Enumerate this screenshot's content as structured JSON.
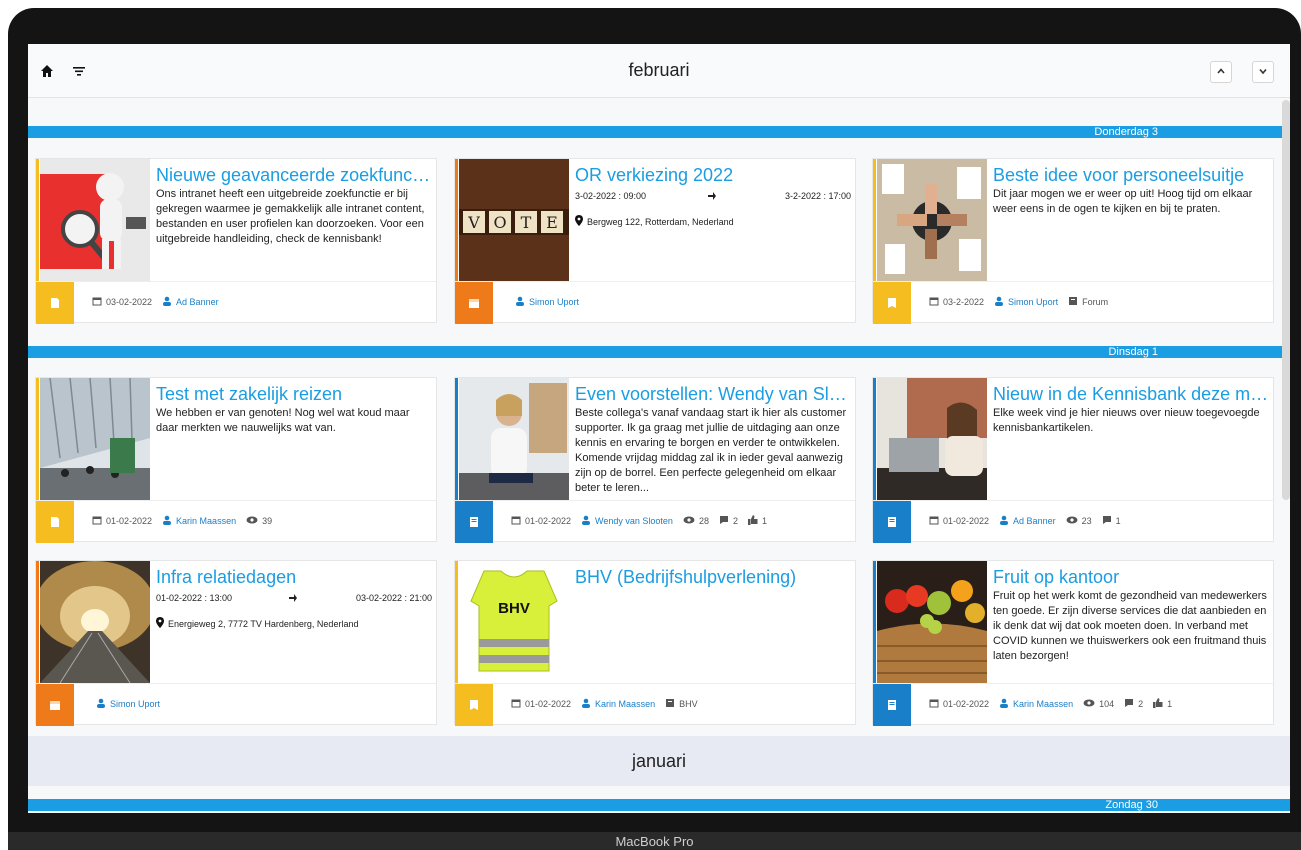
{
  "device": {
    "label": "MacBook Pro"
  },
  "header": {
    "month": "februari",
    "home_icon": "home-icon",
    "filter_icon": "filter-icon"
  },
  "colors": {
    "accent": "#1a9de2",
    "yellow": "#f5bd1f",
    "orange": "#ef7a1a",
    "blue": "#1a7fc9"
  },
  "days": [
    {
      "label": "Donderdag 3"
    },
    {
      "label": "Dinsdag 1"
    },
    {
      "label": "Zondag 30"
    }
  ],
  "cards": [
    {
      "title": "Nieuwe geavanceerde zoekfunc…",
      "body": "Ons intranet heeft een uitgebreide zoekfunctie er bij gekregen waarmee je gemakkelijk alle intranet content, bestanden en user profielen kan doorzoeken. Voor een uitgebreide handleiding, check de kennisbank!",
      "date": "03-02-2022",
      "author": "Ad Banner"
    },
    {
      "title": "OR verkiezing 2022",
      "start": "3-02-2022 : 09:00",
      "end": "3-2-2022 : 17:00",
      "location": "Bergweg 122, Rotterdam, Nederland",
      "author": "Simon Uport",
      "thumb_text": "VOTE"
    },
    {
      "title": "Beste idee voor personeelsuitje",
      "body": "Dit jaar mogen we er weer op uit! Hoog tijd om elkaar weer eens in de ogen te kijken en bij te praten.",
      "date": "03-2-2022",
      "author": "Simon Uport",
      "forum": "Forum"
    },
    {
      "title": "Test met zakelijk reizen",
      "body": "We hebben er van genoten! Nog wel wat koud maar daar merkten we nauwelijks wat van.",
      "date": "01-02-2022",
      "author": "Karin Maassen",
      "views": "39"
    },
    {
      "title": "Even voorstellen: Wendy van Sl…",
      "body": "Beste collega's vanaf vandaag start ik hier als customer supporter. Ik ga graag met jullie de uitdaging aan onze kennis en ervaring te borgen en verder te ontwikkelen. Komende vrijdag middag zal ik in ieder geval aanwezig zijn op de borrel. Een perfecte gelegenheid om elkaar beter te leren...",
      "date": "01-02-2022",
      "author": "Wendy van Slooten",
      "views": "28",
      "comments": "2",
      "likes": "1"
    },
    {
      "title": "Nieuw in de Kennisbank deze m…",
      "body": "Elke week vind je hier nieuws over nieuw toegevoegde kennisbankartikelen.",
      "date": "01-02-2022",
      "author": "Ad Banner",
      "views": "23",
      "comments": "1"
    },
    {
      "title": "Infra relatiedagen",
      "start": "01-02-2022 : 13:00",
      "end": "03-02-2022 : 21:00",
      "location": "Energieweg 2, 7772 TV Hardenberg, Nederland",
      "author": "Simon Uport"
    },
    {
      "title": "BHV (Bedrijfshulpverlening)",
      "date": "01-02-2022",
      "author": "Karin Maassen",
      "forum": "BHV",
      "thumb_text": "BHV"
    },
    {
      "title": "Fruit op kantoor",
      "body": "Fruit op het werk komt de gezondheid van medewerkers ten goede. Er zijn diverse services die dat aanbieden en ik denk dat wij dat ook moeten doen. In verband met COVID kunnen we thuiswerkers ook een fruitmand thuis laten bezorgen!",
      "date": "01-02-2022",
      "author": "Karin Maassen",
      "views": "104",
      "comments": "2",
      "likes": "1"
    }
  ],
  "next_month": "januari"
}
